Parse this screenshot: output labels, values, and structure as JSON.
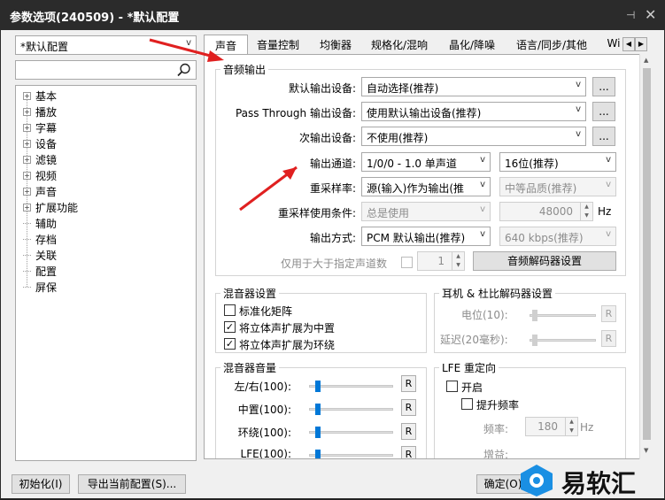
{
  "window": {
    "title": "参数选项(240509) - *默认配置",
    "pin": "⊣",
    "close": "✕"
  },
  "profile": {
    "selected": "*默认配置"
  },
  "search": {
    "value": ""
  },
  "tree": {
    "expandable": [
      "基本",
      "播放",
      "字幕",
      "设备",
      "滤镜",
      "视频",
      "声音",
      "扩展功能"
    ],
    "leaves": [
      "辅助",
      "存档",
      "关联",
      "配置",
      "屏保"
    ]
  },
  "tabs": [
    "声音",
    "音量控制",
    "均衡器",
    "规格化/混响",
    "晶化/降噪",
    "语言/同步/其他",
    "Wi"
  ],
  "audio_output": {
    "title": "音频输出",
    "default_device_label": "默认输出设备:",
    "default_device_value": "自动选择(推荐)",
    "passthrough_label": "Pass Through 输出设备:",
    "passthrough_value": "使用默认输出设备(推荐)",
    "secondary_label": "次输出设备:",
    "secondary_value": "不使用(推荐)",
    "more_label": "...",
    "channel_label": "输出通道:",
    "channel_value": "1/0/0 - 1.0 单声道",
    "bits_value": "16位(推荐)",
    "resample_label": "重采样率:",
    "resample_value": "源(输入)作为输出(推",
    "quality_value": "中等品质(推荐)",
    "resample_cond_label": "重采样使用条件:",
    "resample_cond_value": "总是使用",
    "rate_value": "48000",
    "rate_unit": "Hz",
    "output_mode_label": "输出方式:",
    "output_mode_value": "PCM 默认输出(推荐)",
    "bitrate_value": "640 kbps(推荐)",
    "only_channels_label": "仅用于大于指定声道数",
    "only_channels_value": "1",
    "decoder_btn": "音频解码器设置"
  },
  "mixer": {
    "title": "混音器设置",
    "normalize": "标准化矩阵",
    "stereo_center": "将立体声扩展为中置",
    "stereo_surround": "将立体声扩展为环绕",
    "check_mark": "✓"
  },
  "headphone": {
    "title": "耳机 & 杜比解码器设置",
    "level": "电位(10):",
    "delay": "延迟(20毫秒):",
    "r": "R"
  },
  "mixer_volume": {
    "title": "混音器音量",
    "rows": [
      {
        "label": "左/右(100):",
        "level": 0.08
      },
      {
        "label": "中置(100):",
        "level": 0.08
      },
      {
        "label": "环绕(100):",
        "level": 0.08
      },
      {
        "label": "LFE(100):",
        "level": 0.08
      }
    ],
    "r": "R"
  },
  "lfe": {
    "title": "LFE 重定向",
    "enable": "开启",
    "boost": "提升频率",
    "freq_label": "频率:",
    "freq_value": "180",
    "freq_unit": "Hz",
    "gain_label": "增益:"
  },
  "footer": {
    "init": "初始化(I)",
    "export": "导出当前配置(S)...",
    "ok": "确定(O)"
  },
  "watermark": {
    "text": "易软汇"
  },
  "colors": {
    "accent": "#0078d7",
    "annotation": "#e02020",
    "titlebar": "#2b2b2b"
  }
}
